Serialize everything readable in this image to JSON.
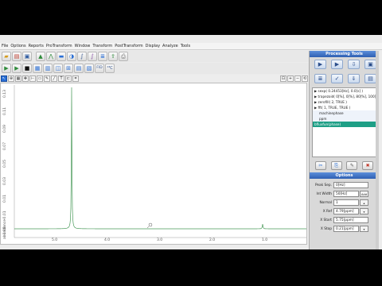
{
  "menubar": {
    "items": [
      "File",
      "Options",
      "Reports",
      "ProTransform",
      "Window",
      "Transform",
      "PostTransform",
      "Display",
      "Analyze",
      "Tools"
    ]
  },
  "toolbar1": {
    "icons": [
      "folder-open-icon",
      "folder-icon",
      "save-icon",
      "spectrum-icon",
      "peak-pick-icon",
      "baseline-icon",
      "phase-icon",
      "integrate-icon",
      "integral-icon",
      "stack-icon",
      "export-icon",
      "print-icon"
    ]
  },
  "toolbar2": {
    "icons": [
      "play-icon",
      "play-alt-icon",
      "stop-icon",
      "grid-icon",
      "layout-icon",
      "split-icon",
      "merge-icon",
      "table-icon",
      "fit-icon",
      "fid-icon",
      "carbon-icon"
    ],
    "fid_label": "FID",
    "carbon_label": "¹³C"
  },
  "plot": {
    "y_ticks": [
      "0.13",
      "0.11",
      "0.09",
      "0.07",
      "0.05",
      "0.03",
      "0.01",
      "-0.01",
      "-0.03"
    ],
    "y_label": "abundance",
    "x_ticks": [
      "5.0",
      "4.0",
      "3.0",
      "2.0",
      "1.0"
    ],
    "x_label": "X : parts per Million : 1H",
    "trace_color": "#4a9a5a"
  },
  "processing": {
    "title": "Processing Tools",
    "list": [
      {
        "text": "▶ sexp( 0.24453[Hz], 0.0[s] )",
        "kind": "normal"
      },
      {
        "text": "▶ trapezoid( 0[%], 0[%], 80[%], 100[...",
        "kind": "normal"
      },
      {
        "text": "▶ zerofill( 2, TRUE )",
        "kind": "normal"
      },
      {
        "text": "▶ fft( 1, TRUE, TRUE )",
        "kind": "normal"
      },
      {
        "text": "machinephase",
        "kind": "sub"
      },
      {
        "text": "ppm",
        "kind": "sub"
      },
      {
        "text": "bfluxfun(phase)",
        "kind": "sel"
      }
    ]
  },
  "options": {
    "title": "Options",
    "fields": [
      {
        "label": "Peak Sep.",
        "value": "0[Hz]",
        "button": ""
      },
      {
        "label": "Int Width",
        "value": "50[Hz]",
        "button": "Add"
      },
      {
        "label": "Normal",
        "value": "1",
        "button": ""
      },
      {
        "label": "X Ref",
        "value": "4.79[ppm]",
        "button": ""
      },
      {
        "label": "X Start",
        "value": "5.75[ppm]",
        "button": ""
      },
      {
        "label": "X Stop",
        "value": "0.21[ppm]",
        "button": ""
      }
    ]
  }
}
